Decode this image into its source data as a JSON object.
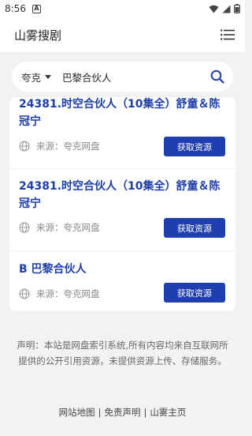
{
  "status_bar": {
    "time": "8:56",
    "notification": "A"
  },
  "header": {
    "title": "山雾搜剧"
  },
  "search": {
    "type_label": "夸克",
    "query": "巴黎合伙人"
  },
  "results": [
    {
      "title": "24381.时空合伙人（10集全）舒童＆陈冠宁",
      "source": "来源：夸克网盘",
      "button": "获取资源"
    },
    {
      "title": "24381.时空合伙人（10集全）舒童＆陈冠宁",
      "source": "来源：夸克网盘",
      "button": "获取资源"
    },
    {
      "title": "B 巴黎合伙人",
      "source": "来源：夸克网盘",
      "button": "获取资源"
    }
  ],
  "footer": {
    "disclaimer": "声明：本站是网盘索引系统,所有内容均来自互联网所提供的公开引用资源，未提供资源上传、存储服务。",
    "links": [
      "网站地图",
      "免责声明",
      "山雾主页"
    ],
    "separator": "|"
  },
  "colors": {
    "accent": "#1f3eb0",
    "title_link": "#1e3fa6",
    "background": "#f2f2f4"
  }
}
